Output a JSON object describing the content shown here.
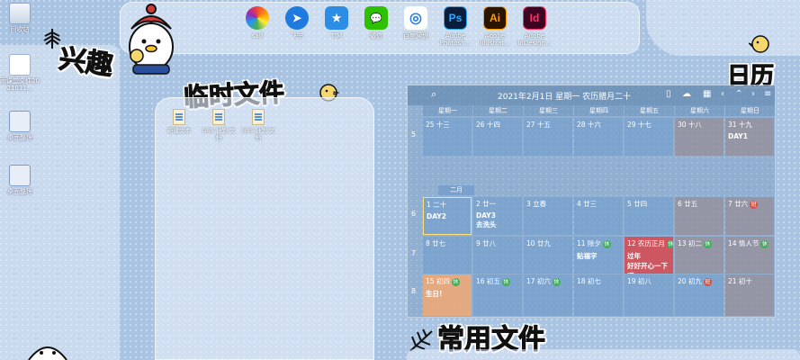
{
  "desktop_icons": [
    {
      "label": "回收站",
      "icon": "recycle-bin-icon"
    },
    {
      "label": "雨课堂文件2021011...",
      "icon": "document-icon"
    },
    {
      "label": "桌面整理",
      "icon": "folder-icon"
    },
    {
      "label": "桌面整理",
      "icon": "folder-icon"
    }
  ],
  "dock": [
    {
      "label": "saif",
      "icon": "color-wheel-icon",
      "glyph": "",
      "color": "#f0a030"
    },
    {
      "label": "飞书",
      "icon": "feishu-icon",
      "glyph": "➤",
      "color": "#1f7ae0"
    },
    {
      "label": "TIM",
      "icon": "tim-icon",
      "glyph": "★",
      "color": "#2b8de6"
    },
    {
      "label": "微信",
      "icon": "wechat-icon",
      "glyph": "💬",
      "color": "#2dc100"
    },
    {
      "label": "百度网盘",
      "icon": "cloud-disk-icon",
      "glyph": "◎",
      "color": "#ffffff"
    },
    {
      "label": "Adobe Photosh...",
      "icon": "photoshop-icon",
      "glyph": "Ps",
      "color": "#0a1e3c"
    },
    {
      "label": "Adobe Illustrat...",
      "icon": "illustrator-icon",
      "glyph": "Ai",
      "color": "#2b1400"
    },
    {
      "label": "Adobe InDesign...",
      "icon": "indesign-icon",
      "glyph": "Id",
      "color": "#3d0320"
    }
  ],
  "headings": {
    "interest": "兴趣",
    "temp_files": "临时文件",
    "calendar": "日历",
    "common_files": "常用文件"
  },
  "temp_files": [
    {
      "label": "新建文本"
    },
    {
      "label": "GSS 计划 文档"
    },
    {
      "label": "GSS 计划 文档"
    }
  ],
  "calendar": {
    "title": "2021年2月1日  星期一  农历腊月二十",
    "weekdays": [
      "星期一",
      "星期二",
      "星期三",
      "星期四",
      "星期五",
      "星期六",
      "星期日"
    ],
    "month_tag": "二月",
    "weeks": [
      {
        "num": "5",
        "days": [
          {
            "d": "25 十三",
            "ev": ""
          },
          {
            "d": "26 十四",
            "ev": ""
          },
          {
            "d": "27 十五",
            "ev": ""
          },
          {
            "d": "28 十六",
            "ev": ""
          },
          {
            "d": "29 十七",
            "ev": ""
          },
          {
            "d": "30 十八",
            "ev": ""
          },
          {
            "d": "31 十九",
            "ev": "DAY1"
          }
        ]
      },
      {
        "num": "6",
        "days": [
          {
            "d": "1 二十",
            "ev": "DAY2"
          },
          {
            "d": "2 廿一",
            "ev": "DAY3\n去洗头"
          },
          {
            "d": "3 立春",
            "ev": ""
          },
          {
            "d": "4 廿三",
            "ev": ""
          },
          {
            "d": "5 廿四",
            "ev": ""
          },
          {
            "d": "6 廿五",
            "ev": ""
          },
          {
            "d": "7 廿六",
            "ev": "",
            "badge": "班"
          }
        ]
      },
      {
        "num": "7",
        "days": [
          {
            "d": "8 廿七",
            "ev": ""
          },
          {
            "d": "9 廿八",
            "ev": ""
          },
          {
            "d": "10 廿九",
            "ev": ""
          },
          {
            "d": "11 除夕",
            "ev": "贴福字",
            "badge": "休"
          },
          {
            "d": "12 农历正月",
            "ev": "过年\n好好开心一下吧",
            "badge": "休"
          },
          {
            "d": "13 初二",
            "ev": "",
            "badge": "休"
          },
          {
            "d": "14 情人节",
            "ev": "",
            "badge": "休"
          }
        ]
      },
      {
        "num": "8",
        "days": [
          {
            "d": "15 初四",
            "ev": "生日!",
            "badge": "休"
          },
          {
            "d": "16 初五",
            "ev": "",
            "badge": "休"
          },
          {
            "d": "17 初六",
            "ev": "",
            "badge": "休"
          },
          {
            "d": "18 初七",
            "ev": ""
          },
          {
            "d": "19 初八",
            "ev": ""
          },
          {
            "d": "20 初九",
            "ev": "",
            "badge": "班"
          },
          {
            "d": "21 初十",
            "ev": ""
          }
        ]
      }
    ]
  },
  "colors": {
    "background": "#a9c4e2",
    "rest_badge": "#3fae5b",
    "work_badge": "#d94b3c",
    "festival": "#d6484e",
    "birthday": "#eca878"
  }
}
